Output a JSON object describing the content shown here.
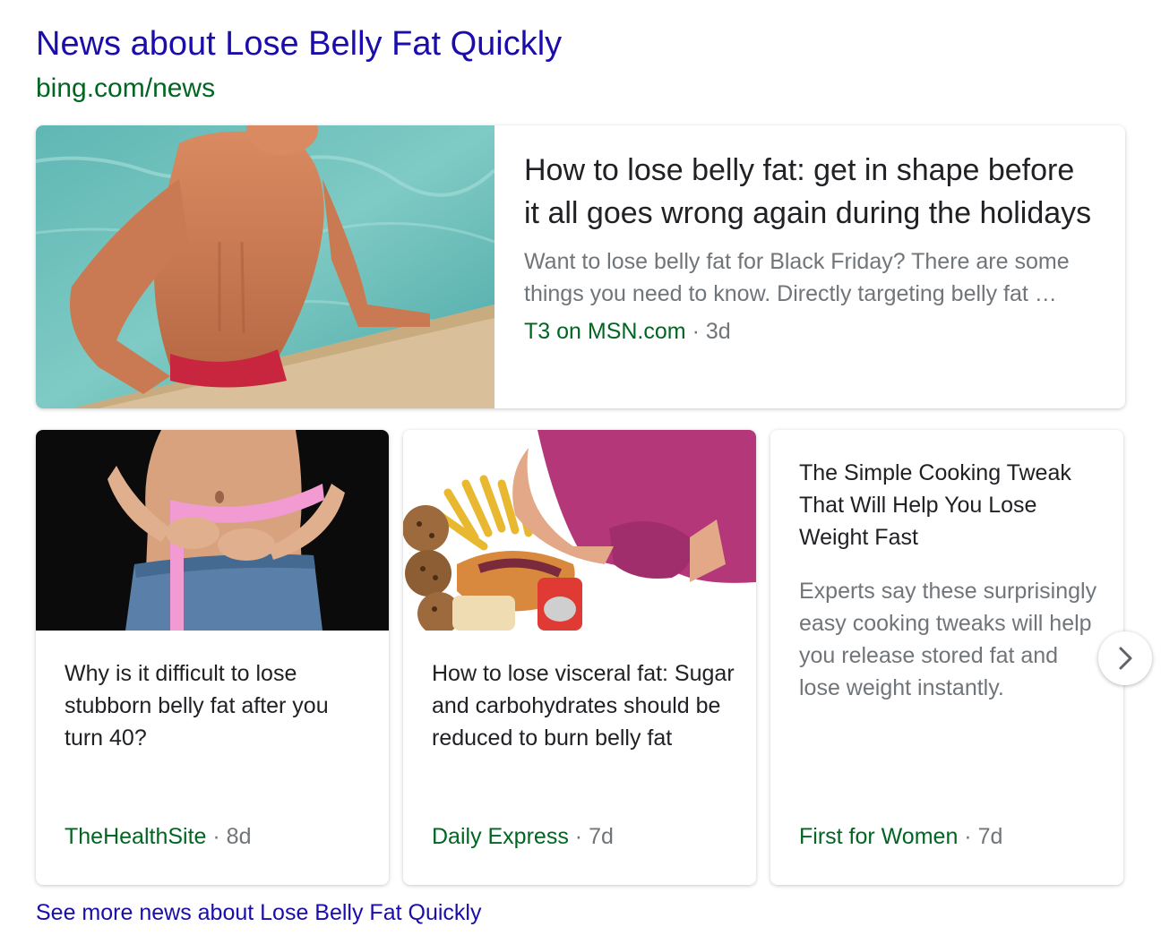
{
  "header": {
    "title": "News about Lose Belly Fat Quickly",
    "url": "bing.com/news"
  },
  "featured": {
    "title": "How to lose belly fat: get in shape before it all goes wrong again during the holidays",
    "snippet": "Want to lose belly fat for Black Friday? There are some things you need to know. Directly targeting belly fat …",
    "source": "T3 on MSN.com",
    "separator": "·",
    "age": "3d",
    "image": "man-in-pool-image"
  },
  "cards": [
    {
      "title": "Why is it difficult to lose stubborn belly fat after you turn 40?",
      "source": "TheHealthSite",
      "separator": "·",
      "age": "8d",
      "image": "measuring-tape-waist-image"
    },
    {
      "title": "How to lose visceral fat: Sugar and carbohydrates should be reduced to burn belly fat",
      "source": "Daily Express",
      "separator": "·",
      "age": "7d",
      "image": "junk-food-belly-image"
    },
    {
      "title": "The Simple Cooking Tweak That Will Help You Lose Weight Fast",
      "snippet": "Experts say these surprisingly easy cooking tweaks will help you release stored fat and lose weight instantly.",
      "source": "First for Women",
      "separator": "·",
      "age": "7d"
    }
  ],
  "next_icon": "chevron-right-icon",
  "see_more": "See more news about Lose Belly Fat Quickly",
  "colors": {
    "link": "#1a0dab",
    "url_green": "#006621",
    "text": "#202124",
    "muted": "#70757a"
  }
}
